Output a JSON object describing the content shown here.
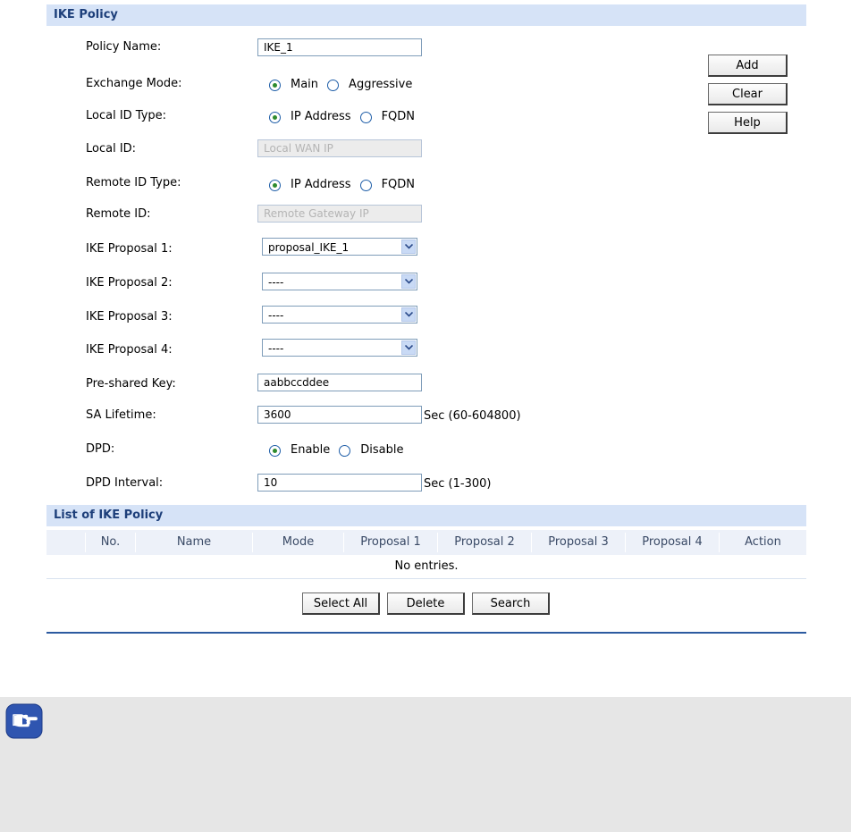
{
  "ike_policy": {
    "section_title": "IKE Policy",
    "policy_name": {
      "label": "Policy Name:",
      "value": "IKE_1"
    },
    "exchange_mode": {
      "label": "Exchange Mode:",
      "options": [
        "Main",
        "Aggressive"
      ],
      "selected": "Main"
    },
    "local_id_type": {
      "label": "Local ID Type:",
      "options": [
        "IP Address",
        "FQDN"
      ],
      "selected": "IP Address"
    },
    "local_id": {
      "label": "Local ID:",
      "placeholder": "Local WAN IP"
    },
    "remote_id_type": {
      "label": "Remote ID Type:",
      "options": [
        "IP Address",
        "FQDN"
      ],
      "selected": "IP Address"
    },
    "remote_id": {
      "label": "Remote ID:",
      "placeholder": "Remote Gateway IP"
    },
    "proposals": [
      {
        "label": "IKE Proposal 1:",
        "value": "proposal_IKE_1"
      },
      {
        "label": "IKE Proposal 2:",
        "value": "----"
      },
      {
        "label": "IKE Proposal 3:",
        "value": "----"
      },
      {
        "label": "IKE Proposal 4:",
        "value": "----"
      }
    ],
    "pre_shared_key": {
      "label": "Pre-shared Key:",
      "value": "aabbccddee"
    },
    "sa_lifetime": {
      "label": "SA Lifetime:",
      "value": "3600",
      "unit": "Sec (60-604800)"
    },
    "dpd": {
      "label": "DPD:",
      "options": [
        "Enable",
        "Disable"
      ],
      "selected": "Enable"
    },
    "dpd_interval": {
      "label": "DPD Interval:",
      "value": "10",
      "unit": "Sec (1-300)"
    },
    "buttons": {
      "add": "Add",
      "clear": "Clear",
      "help": "Help"
    }
  },
  "list": {
    "section_title": "List of IKE Policy",
    "columns": [
      "No.",
      "Name",
      "Mode",
      "Proposal 1",
      "Proposal 2",
      "Proposal 3",
      "Proposal 4",
      "Action"
    ],
    "empty_text": "No entries.",
    "buttons": {
      "select_all": "Select All",
      "delete": "Delete",
      "search": "Search"
    }
  },
  "note": {
    "icon": "pointing-hand-icon",
    "icon_color": "#2f55b0"
  },
  "colors": {
    "section_bar": "#d6e3f7",
    "section_title": "#1d3f7a",
    "rule": "#2c5aa0",
    "note_bg": "#e6e6e6"
  }
}
